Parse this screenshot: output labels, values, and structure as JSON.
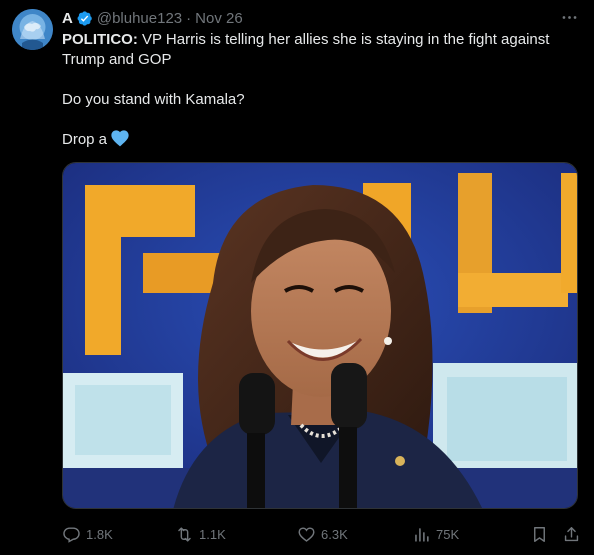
{
  "tweet": {
    "display_name": "A",
    "handle": "@bluhue123",
    "separator": "·",
    "date": "Nov 26",
    "text_source": "POLITICO:",
    "text_body": " VP Harris is telling her allies she is staying in the fight against Trump and GOP",
    "question": "Do you stand with Kamala?",
    "drop": "Drop a",
    "heart_emoji": "blue-heart",
    "colors": {
      "background": "#000000",
      "text": "#e7e9ea",
      "muted": "#71767b",
      "verified": "#1d9bf0",
      "heart": "#5eb4f0"
    }
  },
  "actions": {
    "replies": "1.8K",
    "reposts": "1.1K",
    "likes": "6.3K",
    "views": "75K"
  },
  "icons": {
    "more": "more-dots-icon",
    "reply": "reply-icon",
    "retweet": "retweet-icon",
    "like": "heart-icon",
    "views": "views-bar-chart-icon",
    "bookmark": "bookmark-icon",
    "share": "share-icon",
    "verified": "verified-badge-icon"
  }
}
